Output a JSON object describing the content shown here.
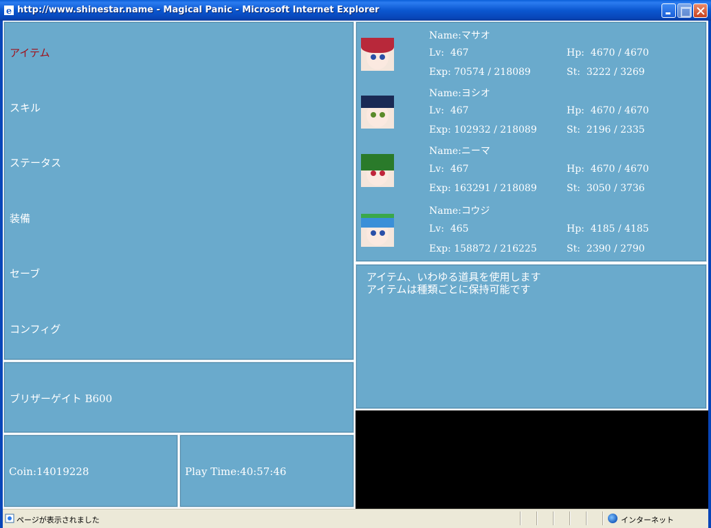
{
  "window": {
    "title": "http://www.shinestar.name - Magical Panic - Microsoft Internet Explorer"
  },
  "menu": {
    "items": [
      {
        "label": "アイテム",
        "active": true
      },
      {
        "label": "スキル",
        "active": false
      },
      {
        "label": "ステータス",
        "active": false
      },
      {
        "label": "装備",
        "active": false
      },
      {
        "label": "セーブ",
        "active": false
      },
      {
        "label": "コンフィグ",
        "active": false
      }
    ]
  },
  "location": "ブリザーゲイト B600",
  "coin": "Coin:14019228",
  "play_time": "Play Time:40:57:46",
  "party": [
    {
      "name": "Name:マサオ",
      "lv": "Lv:  467",
      "hp": "Hp:  4670 / 4670",
      "exp": "Exp: 70574 / 218089",
      "st": "St:  3222 / 3269",
      "hair_color": "#b8283a",
      "eye_color": "#2a4fa8"
    },
    {
      "name": "Name:ヨシオ",
      "lv": "Lv:  467",
      "hp": "Hp:  4670 / 4670",
      "exp": "Exp: 102932 / 218089",
      "st": "St:  2196 / 2335",
      "hair_color": "#1a2a55",
      "eye_color": "#5a8a2a"
    },
    {
      "name": "Name:ニーマ",
      "lv": "Lv:  467",
      "hp": "Hp:  4670 / 4670",
      "exp": "Exp: 163291 / 218089",
      "st": "St:  3050 / 3736",
      "hair_color": "#2a7a2a",
      "eye_color": "#c0243a"
    },
    {
      "name": "Name:コウジ",
      "lv": "Lv:  465",
      "hp": "Hp:  4185 / 4185",
      "exp": "Exp: 158872 / 216225",
      "st": "St:  2390 / 2790",
      "hair_color": "#3a8fd8",
      "eye_color": "#2a4fa8"
    }
  ],
  "description": {
    "line1": "アイテム、いわゆる道具を使用します",
    "line2": "アイテムは種類ごとに保持可能です"
  },
  "statusbar": {
    "status": "ページが表示されました",
    "zone": "インターネット"
  },
  "colors": {
    "panel_bg": "#6aaacc",
    "active_menu": "#a0101a"
  }
}
